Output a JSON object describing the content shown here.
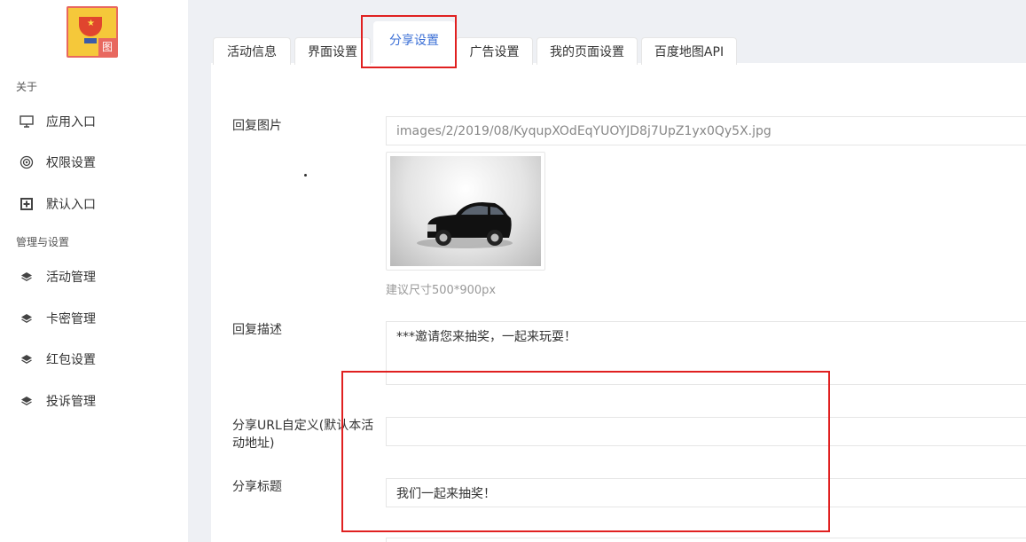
{
  "app": {
    "logo_badge": "图",
    "logo_icon": "trophy-icon"
  },
  "sidebar": {
    "sections": [
      {
        "title": "关于",
        "items": [
          {
            "label": "应用入口",
            "icon": "monitor-icon"
          },
          {
            "label": "权限设置",
            "icon": "target-icon"
          },
          {
            "label": "默认入口",
            "icon": "entry-icon"
          }
        ]
      },
      {
        "title": "管理与设置",
        "items": [
          {
            "label": "活动管理",
            "icon": "layers-icon"
          },
          {
            "label": "卡密管理",
            "icon": "layers-icon"
          },
          {
            "label": "红包设置",
            "icon": "layers-icon"
          },
          {
            "label": "投诉管理",
            "icon": "layers-icon"
          }
        ]
      }
    ]
  },
  "tabs": [
    {
      "label": "活动信息"
    },
    {
      "label": "界面设置"
    },
    {
      "label": "分享设置",
      "active": true
    },
    {
      "label": "广告设置"
    },
    {
      "label": "我的页面设置"
    },
    {
      "label": "百度地图API"
    }
  ],
  "form": {
    "reply_image": {
      "label": "回复图片",
      "value": "images/2/2019/08/KyqupXOdEqYUOYJD8j7UpZ1yx0Qy5X.jpg",
      "hint": "建议尺寸500*900px"
    },
    "reply_desc": {
      "label": "回复描述",
      "value": "***邀请您来抽奖，一起来玩耍！"
    },
    "share_url": {
      "label": "分享URL自定义(默认本活动地址)",
      "value": ""
    },
    "share_title": {
      "label": "分享标题",
      "value": "我们一起来抽奖！"
    }
  },
  "colors": {
    "accent": "#3b6fd6",
    "highlight": "#e02020"
  }
}
